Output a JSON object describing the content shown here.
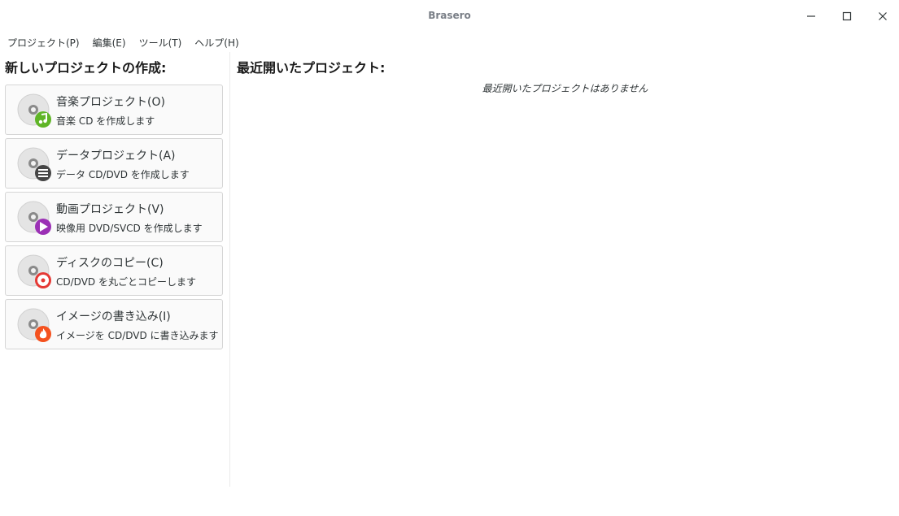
{
  "window": {
    "title": "Brasero",
    "minimize_icon": "minimize-icon",
    "maximize_icon": "maximize-icon",
    "close_icon": "close-icon"
  },
  "menubar": {
    "items": [
      "プロジェクト(P)",
      "編集(E)",
      "ツール(T)",
      "ヘルプ(H)"
    ]
  },
  "new_project": {
    "heading": "新しいプロジェクトの作成:",
    "buttons": [
      {
        "title": "音楽プロジェクト(O)",
        "subtitle": "音楽 CD を作成します",
        "icon": "music-note-icon",
        "badge_color": "#5fb526"
      },
      {
        "title": "データプロジェクト(A)",
        "subtitle": "データ CD/DVD を作成します",
        "icon": "data-list-icon",
        "badge_color": "#454545"
      },
      {
        "title": "動画プロジェクト(V)",
        "subtitle": "映像用 DVD/SVCD を作成します",
        "icon": "play-icon",
        "badge_color": "#9b30b5"
      },
      {
        "title": "ディスクのコピー(C)",
        "subtitle": "CD/DVD を丸ごとコピーします",
        "icon": "disc-copy-icon",
        "badge_color": "#e53935"
      },
      {
        "title": "イメージの書き込み(I)",
        "subtitle": "イメージを CD/DVD に書き込みます",
        "icon": "burn-flame-icon",
        "badge_color": "#f4511e"
      }
    ]
  },
  "recent": {
    "heading": "最近開いたプロジェクト:",
    "empty_message": "最近開いたプロジェクトはありません"
  }
}
